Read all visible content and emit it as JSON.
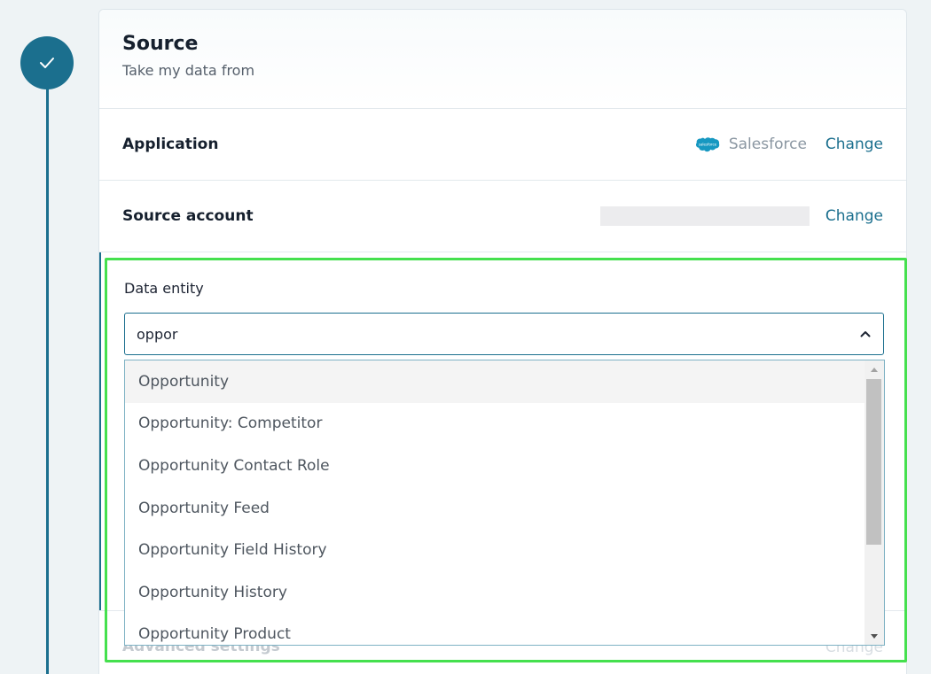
{
  "source": {
    "title": "Source",
    "subtitle": "Take my data from"
  },
  "application": {
    "label": "Application",
    "app_name": "Salesforce",
    "change_label": "Change"
  },
  "source_account": {
    "label": "Source account",
    "change_label": "Change"
  },
  "data_entity": {
    "label": "Data entity",
    "search_value": "oppor",
    "options": [
      "Opportunity",
      "Opportunity: Competitor",
      "Opportunity Contact Role",
      "Opportunity Feed",
      "Opportunity Field History",
      "Opportunity History",
      "Opportunity Product"
    ]
  },
  "advanced": {
    "label": "Advanced settings",
    "change_label": "Change"
  },
  "colors": {
    "accent": "#1b6f8e",
    "highlight": "#45e04e",
    "salesforce": "#1798c1"
  }
}
